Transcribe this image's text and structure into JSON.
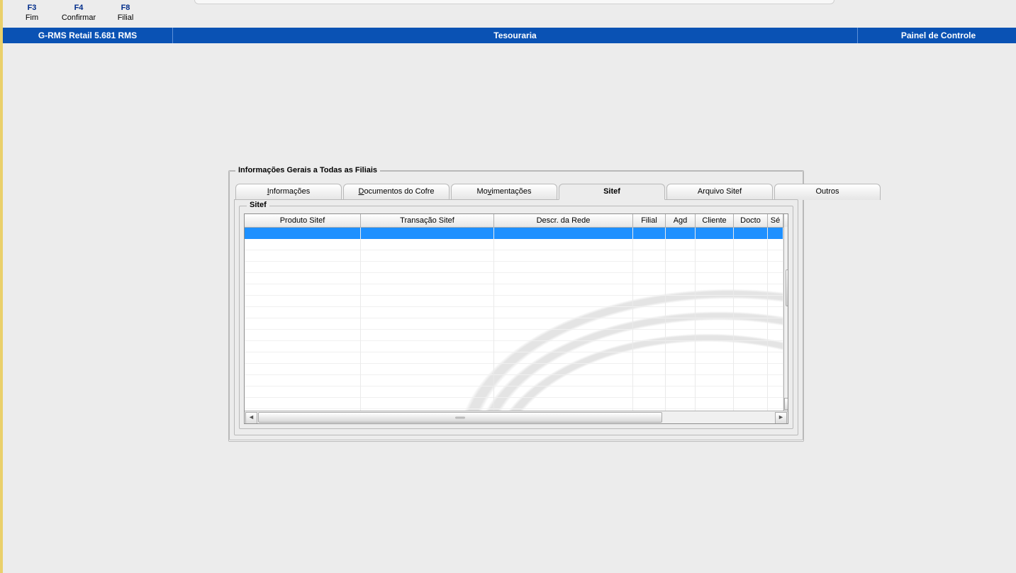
{
  "fkeys": [
    {
      "key": "F3",
      "label": "Fim"
    },
    {
      "key": "F4",
      "label": "Confirmar"
    },
    {
      "key": "F8",
      "label": "Filial"
    }
  ],
  "bluebar": {
    "left": "G-RMS Retail 5.681 RMS",
    "center": "Tesouraria",
    "right": "Painel de Controle"
  },
  "panel": {
    "title": "Informações Gerais a Todas as Filiais",
    "tabs": [
      {
        "label": "Informações",
        "hotkey_index": 0
      },
      {
        "label": "Documentos do Cofre",
        "hotkey_index": 0
      },
      {
        "label": "Movimentações",
        "hotkey_index": 2
      },
      {
        "label": "Sitef",
        "hotkey_index": null,
        "active": true
      },
      {
        "label": "Arquivo Sitef",
        "hotkey_index": null
      },
      {
        "label": "Outros",
        "hotkey_index": null
      }
    ],
    "inner_title": "Sitef",
    "grid": {
      "columns": [
        "Produto Sitef",
        "Transação Sitef",
        "Descr. da Rede",
        "Filial",
        "Agd",
        "Cliente",
        "Docto",
        "Sé"
      ],
      "rows": []
    }
  }
}
